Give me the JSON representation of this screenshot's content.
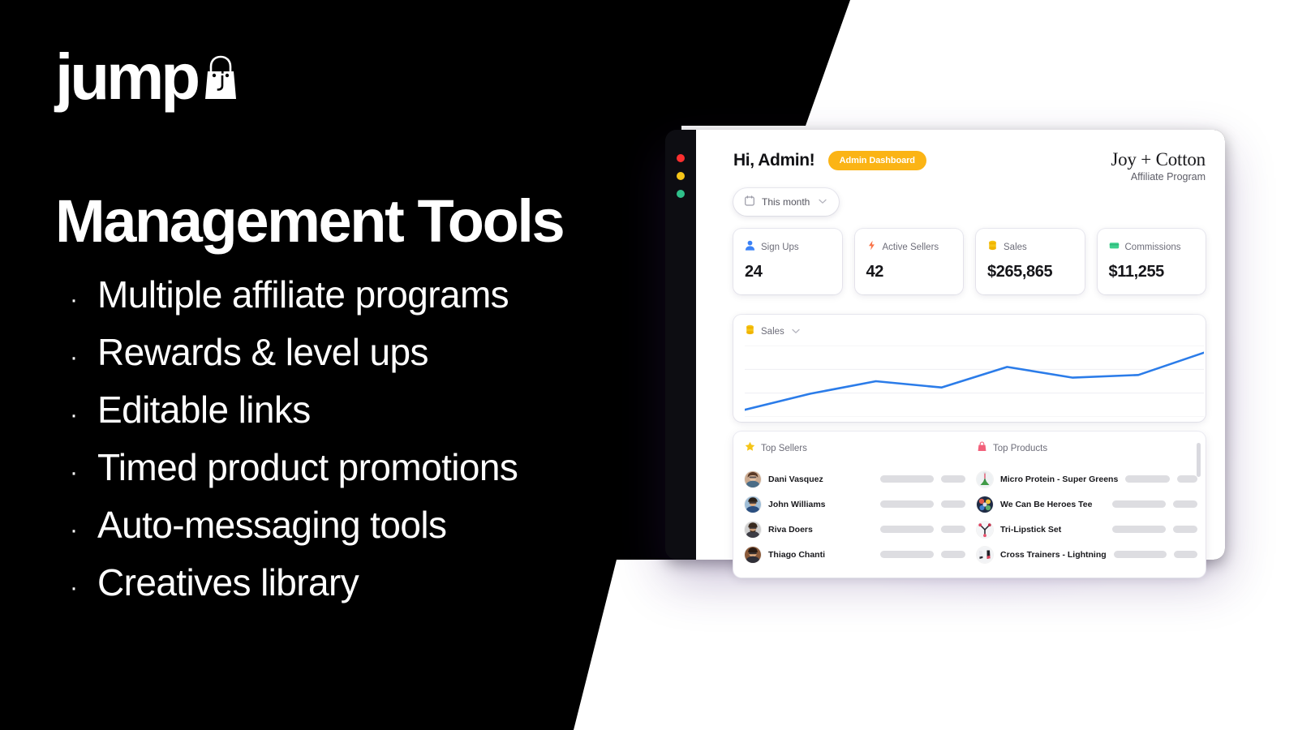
{
  "brandLogo": {
    "word": "jump",
    "icon": "shopping-bag-icon"
  },
  "marketing": {
    "headline": "Management Tools",
    "bullets": [
      "Multiple affiliate programs",
      "Rewards & level ups",
      "Editable links",
      "Timed product promotions",
      "Auto-messaging tools",
      "Creatives library"
    ],
    "bullet_marker": "·"
  },
  "dashboard": {
    "window_controls": [
      "close",
      "minimize",
      "maximize"
    ],
    "greeting": "Hi, Admin!",
    "role_badge": "Admin Dashboard",
    "brand_name": "Joy + Cotton",
    "brand_subtitle": "Affiliate Program",
    "date_filter": {
      "icon": "calendar-icon",
      "label": "This month",
      "chevron": "⌄"
    },
    "stats": [
      {
        "label": "Sign Ups",
        "value": "24",
        "icon": "person-icon",
        "color": "#3b82f6"
      },
      {
        "label": "Active Sellers",
        "value": "42",
        "icon": "bolt-icon",
        "color": "#f97348"
      },
      {
        "label": "Sales",
        "value": "$265,865",
        "icon": "coins-icon",
        "color": "#f5c518"
      },
      {
        "label": "Commissions",
        "value": "$11,255",
        "icon": "wallet-icon",
        "color": "#3ecf8e"
      }
    ],
    "chart_card": {
      "label": "Sales",
      "icon": "coins-icon",
      "chevron": "⌄"
    },
    "top_sellers": {
      "title": "Top Sellers",
      "icon": "star-icon",
      "rows": [
        {
          "name": "Dani Vasquez"
        },
        {
          "name": "John Williams"
        },
        {
          "name": "Riva Doers"
        },
        {
          "name": "Thiago Chanti"
        }
      ]
    },
    "top_products": {
      "title": "Top Products",
      "icon": "shopping-bag-icon",
      "rows": [
        {
          "name": "Micro Protein - Super Greens"
        },
        {
          "name": "We Can Be Heroes Tee"
        },
        {
          "name": "Tri-Lipstick Set"
        },
        {
          "name": "Cross Trainers - Lightning"
        }
      ]
    }
  },
  "chart_data": {
    "type": "line",
    "title": "Sales",
    "series": [
      {
        "name": "Sales",
        "values": [
          8,
          26,
          40,
          33,
          56,
          44,
          47,
          72
        ]
      }
    ],
    "x": [
      1,
      2,
      3,
      4,
      5,
      6,
      7,
      8
    ],
    "xlabel": "",
    "ylabel": "",
    "ylim": [
      0,
      80
    ],
    "grid": true,
    "gridlines": 4,
    "legend": "none",
    "line_color": "#2b7ce9"
  },
  "colors": {
    "background_dark": "#000000",
    "background_light": "#ffffff",
    "accent_yellow": "#fbb415",
    "chart_blue": "#2b7ce9",
    "glow_purple": "#c8aff0"
  }
}
